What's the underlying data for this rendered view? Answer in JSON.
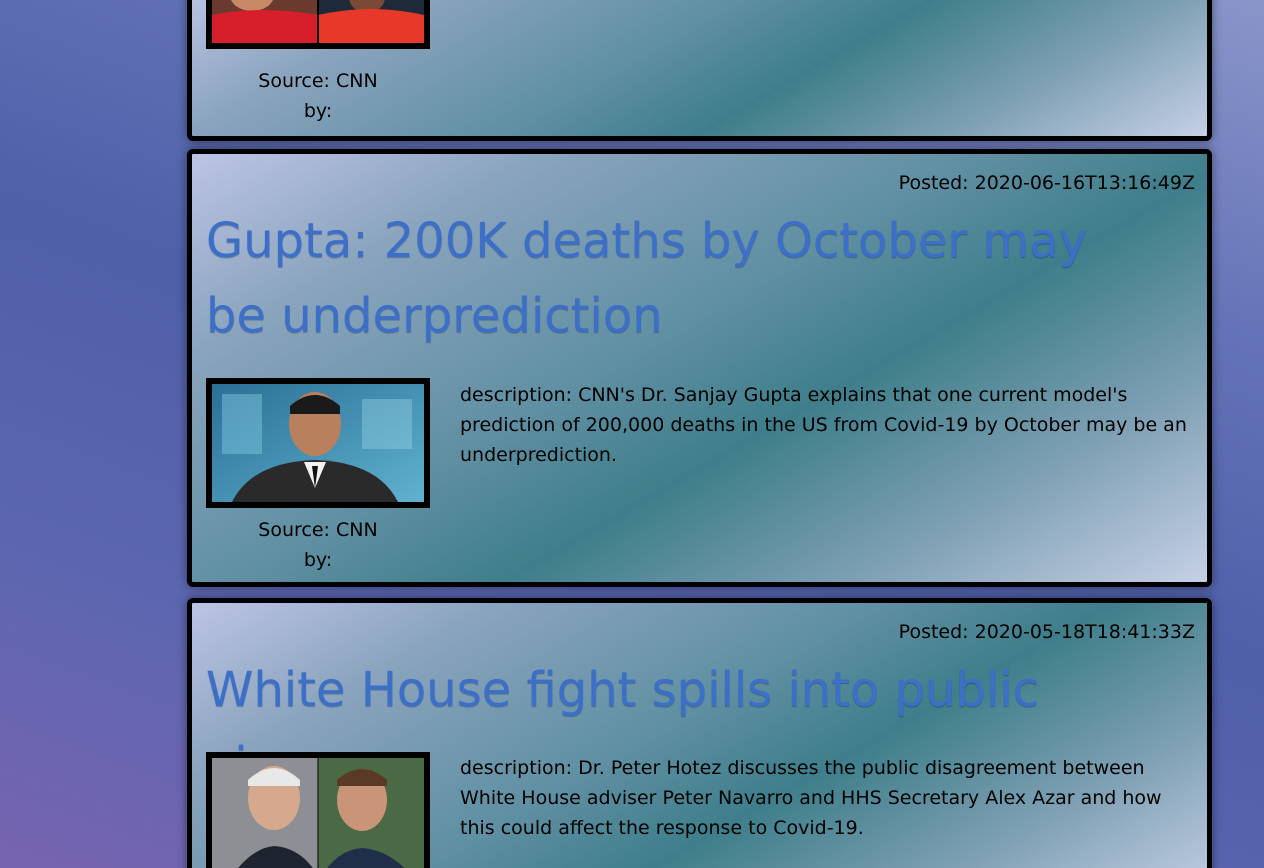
{
  "articles": [
    {
      "source": "Source: CNN",
      "by": "by:"
    },
    {
      "posted": "Posted: 2020-06-16T13:16:49Z",
      "title": "Gupta: 200K deaths by October may be underprediction",
      "description": "description: CNN's Dr. Sanjay Gupta explains that one current model's prediction of 200,000 deaths in the US from Covid-19 by October may be an underprediction.",
      "source": "Source: CNN",
      "by": "by:"
    },
    {
      "posted": "Posted: 2020-05-18T18:41:33Z",
      "title": "White House fight spills into public view",
      "description": "description: Dr. Peter Hotez discusses the public disagreement between White House adviser Peter Navarro and HHS Secretary Alex Azar and how this could affect the response to Covid-19."
    }
  ],
  "colors": {
    "title": "#3b6fc8",
    "border": "#000000"
  }
}
